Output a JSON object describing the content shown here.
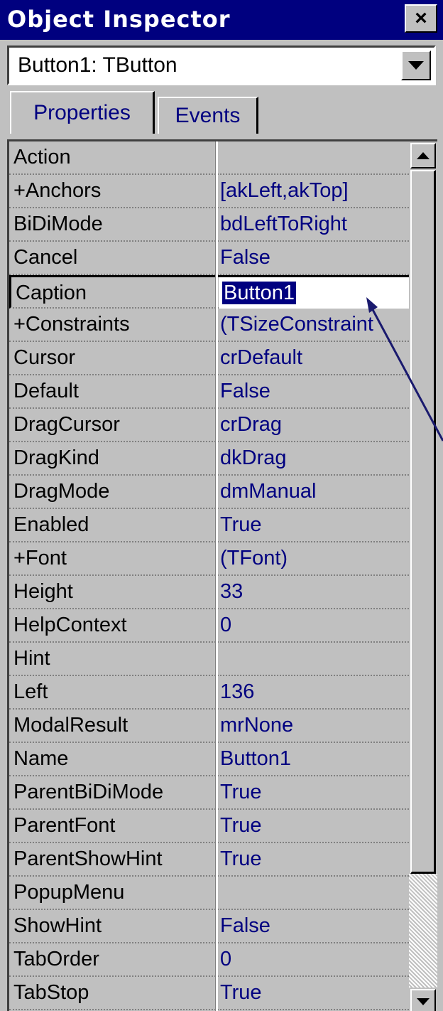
{
  "window": {
    "title": "Object Inspector",
    "close_label": "×"
  },
  "component_selector": {
    "value": "Button1: TButton"
  },
  "tabs": [
    {
      "label": "Properties",
      "active": true
    },
    {
      "label": "Events",
      "active": false
    }
  ],
  "properties": [
    {
      "name": "Action",
      "value": ""
    },
    {
      "name": "+Anchors",
      "value": "[akLeft,akTop]"
    },
    {
      "name": "BiDiMode",
      "value": "bdLeftToRight"
    },
    {
      "name": "Cancel",
      "value": "False"
    },
    {
      "name": "Caption",
      "value": "Button1",
      "selected": true
    },
    {
      "name": "+Constraints",
      "value": "(TSizeConstraint"
    },
    {
      "name": "Cursor",
      "value": "crDefault"
    },
    {
      "name": "Default",
      "value": "False"
    },
    {
      "name": "DragCursor",
      "value": "crDrag"
    },
    {
      "name": "DragKind",
      "value": "dkDrag"
    },
    {
      "name": "DragMode",
      "value": "dmManual"
    },
    {
      "name": "Enabled",
      "value": "True"
    },
    {
      "name": "+Font",
      "value": "(TFont)"
    },
    {
      "name": "Height",
      "value": "33"
    },
    {
      "name": "HelpContext",
      "value": "0"
    },
    {
      "name": "Hint",
      "value": ""
    },
    {
      "name": "Left",
      "value": "136"
    },
    {
      "name": "ModalResult",
      "value": "mrNone"
    },
    {
      "name": "Name",
      "value": "Button1"
    },
    {
      "name": "ParentBiDiMode",
      "value": "True"
    },
    {
      "name": "ParentFont",
      "value": "True"
    },
    {
      "name": "ParentShowHint",
      "value": "True"
    },
    {
      "name": "PopupMenu",
      "value": ""
    },
    {
      "name": "ShowHint",
      "value": "False"
    },
    {
      "name": "TabOrder",
      "value": "0"
    },
    {
      "name": "TabStop",
      "value": "True"
    }
  ],
  "colors": {
    "titlebar": "#00007f",
    "value_text": "#000080",
    "face": "#c0c0c0",
    "annotation_arrow": "#1a1a6e"
  }
}
